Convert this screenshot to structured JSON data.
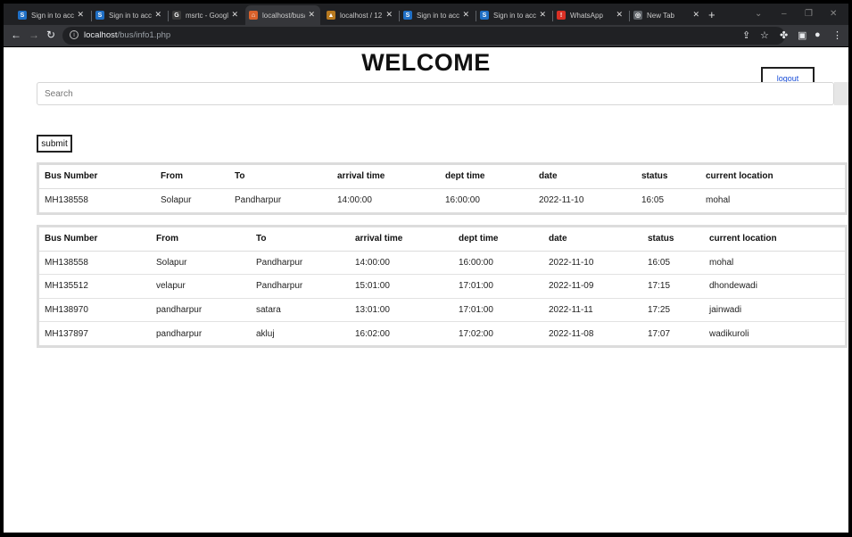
{
  "browser": {
    "tabs": [
      {
        "title": "Sign in to acco",
        "favicon": "S",
        "color": "#1f6fc5"
      },
      {
        "title": "Sign in to acco",
        "favicon": "S",
        "color": "#1f6fc5"
      },
      {
        "title": "msrtc - Googl",
        "favicon": "G",
        "color": "#3b3b3b"
      },
      {
        "title": "localhost/bus/",
        "favicon": "⌂",
        "color": "#d9612b"
      },
      {
        "title": "localhost / 12",
        "favicon": "▲",
        "color": "#b7791f"
      },
      {
        "title": "Sign in to acco",
        "favicon": "S",
        "color": "#1f6fc5"
      },
      {
        "title": "Sign in to acco",
        "favicon": "S",
        "color": "#1f6fc5"
      },
      {
        "title": "WhatsApp",
        "favicon": "!",
        "color": "#d93025"
      },
      {
        "title": "New Tab",
        "favicon": "◎",
        "color": "#5f6368"
      }
    ],
    "new_tab": "+",
    "url_host": "localhost",
    "url_path": "/bus/info1.php"
  },
  "page": {
    "title": "WELCOME",
    "logout_label": "logout",
    "search_placeholder": "Search",
    "submit_label": "submit"
  },
  "result_table": {
    "headers": [
      "Bus Number",
      "From",
      "To",
      "arrival time",
      "dept time",
      "date",
      "status",
      "current location"
    ],
    "rows": [
      [
        "MH138558",
        "Solapur",
        "Pandharpur",
        "14:00:00",
        "16:00:00",
        "2022-11-10",
        "16:05",
        "mohal"
      ]
    ]
  },
  "all_table": {
    "headers": [
      "Bus Number",
      "From",
      "To",
      "arrival time",
      "dept time",
      "date",
      "status",
      "current location"
    ],
    "rows": [
      [
        "MH138558",
        "Solapur",
        "Pandharpur",
        "14:00:00",
        "16:00:00",
        "2022-11-10",
        "16:05",
        "mohal"
      ],
      [
        "MH135512",
        "velapur",
        "Pandharpur",
        "15:01:00",
        "17:01:00",
        "2022-11-09",
        "17:15",
        "dhondewadi"
      ],
      [
        "MH138970",
        "pandharpur",
        "satara",
        "13:01:00",
        "17:01:00",
        "2022-11-11",
        "17:25",
        "jainwadi"
      ],
      [
        "MH137897",
        "pandharpur",
        "akluj",
        "16:02:00",
        "17:02:00",
        "2022-11-08",
        "17:07",
        "wadikuroli"
      ]
    ]
  }
}
